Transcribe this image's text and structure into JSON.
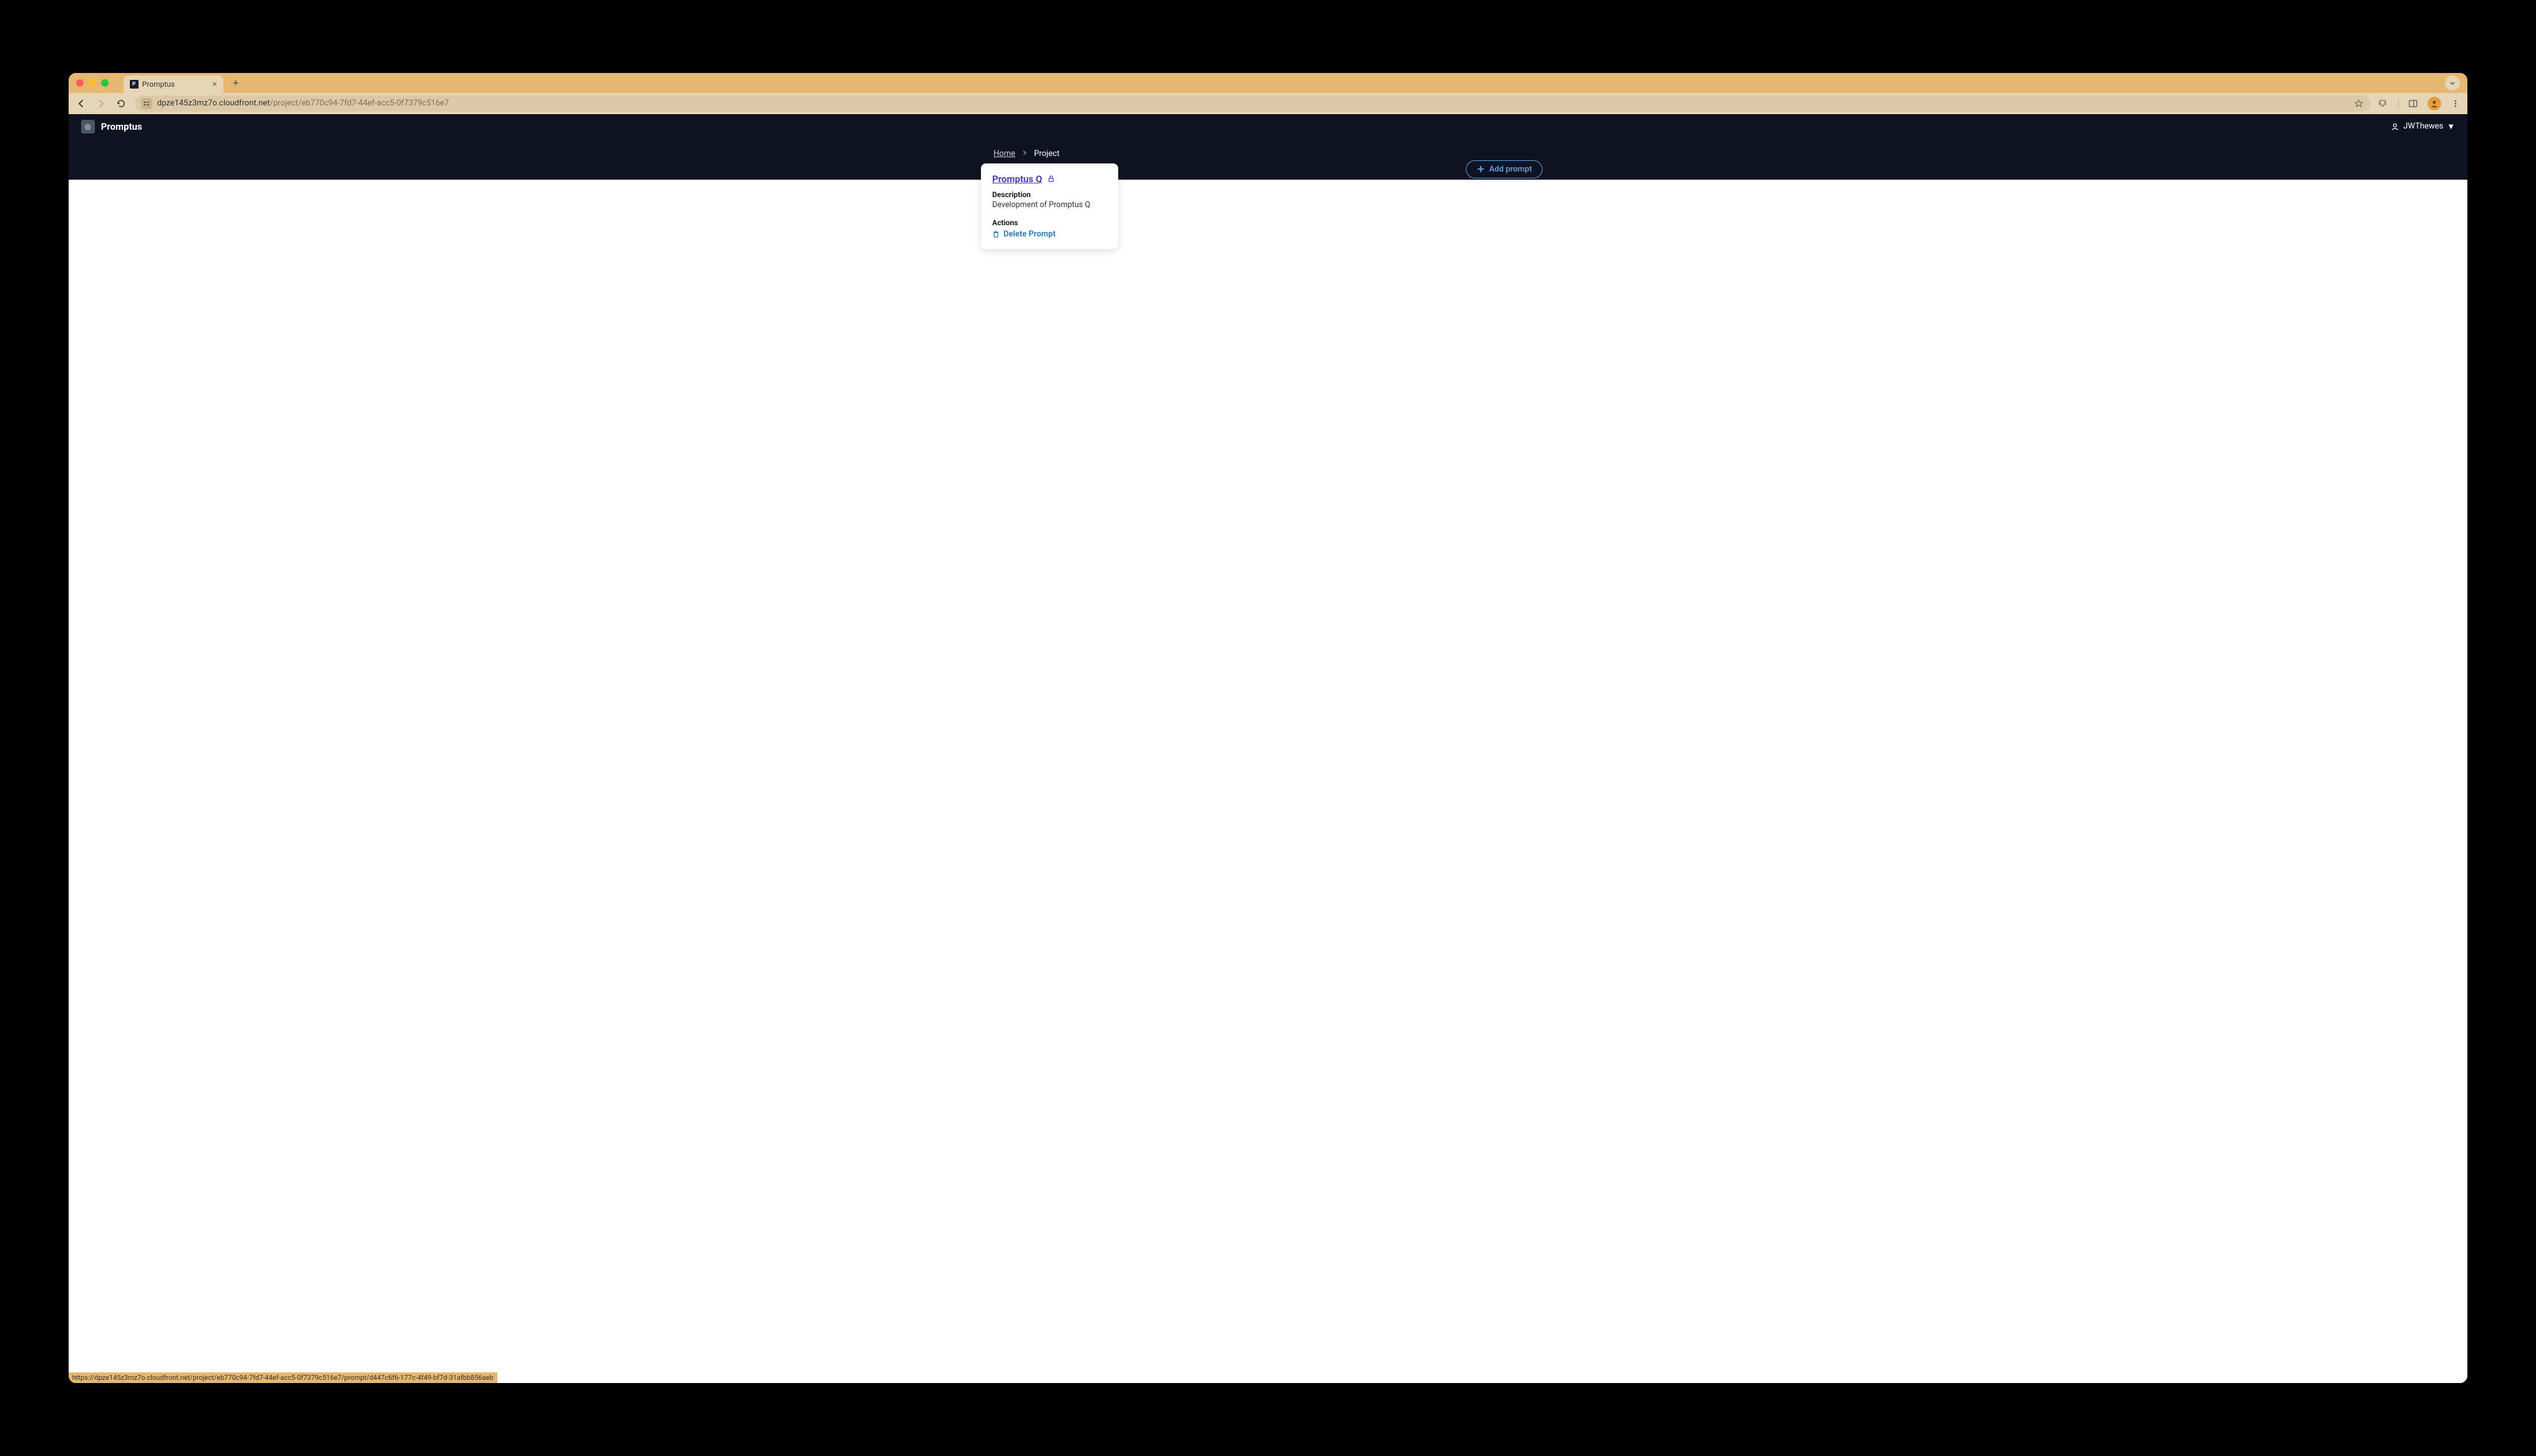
{
  "browser": {
    "tab_title": "Promptus",
    "url_domain": "dpze145z3mz7o.cloudfront.net",
    "url_path": "/project/eb770c94-7fd7-44ef-acc5-0f7379c516e7",
    "status_url": "https://dpze145z3mz7o.cloudfront.net/project/eb770c94-7fd7-44ef-acc5-0f7379c516e7/prompt/d447c6f6-177c-4f49-bf7d-31afbb856aeb"
  },
  "header": {
    "app_name": "Promptus",
    "username": "JWThewes"
  },
  "breadcrumb": {
    "home": "Home",
    "current": "Project"
  },
  "actions": {
    "add_prompt": "Add prompt"
  },
  "card": {
    "title": "Promptus Q",
    "desc_label": "Description",
    "desc_text": "Development of Promptus Q",
    "actions_label": "Actions",
    "delete_label": "Delete Prompt"
  }
}
